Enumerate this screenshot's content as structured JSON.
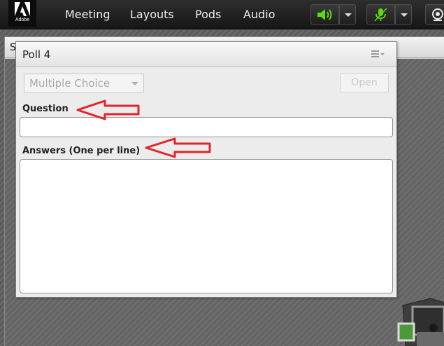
{
  "menubar": {
    "logo_text": "Adobe",
    "items": [
      {
        "label": "Meeting"
      },
      {
        "label": "Layouts"
      },
      {
        "label": "Pods"
      },
      {
        "label": "Audio"
      }
    ],
    "speaker_icon": "speaker-icon",
    "mic_icon": "microphone-muted-icon",
    "camera_icon": "webcam-icon",
    "accent_color": "#5fd80e"
  },
  "background_pod": {
    "title_fragment": "S"
  },
  "poll": {
    "title": "Poll 4",
    "menu_icon": "pod-options-icon",
    "question_type": "Multiple Choice",
    "open_label": "Open",
    "question_label": "Question",
    "question_value": "",
    "answers_label": "Answers (One per line)",
    "answers_value": ""
  },
  "annotations": {
    "arrow_color": "#e3242b"
  }
}
